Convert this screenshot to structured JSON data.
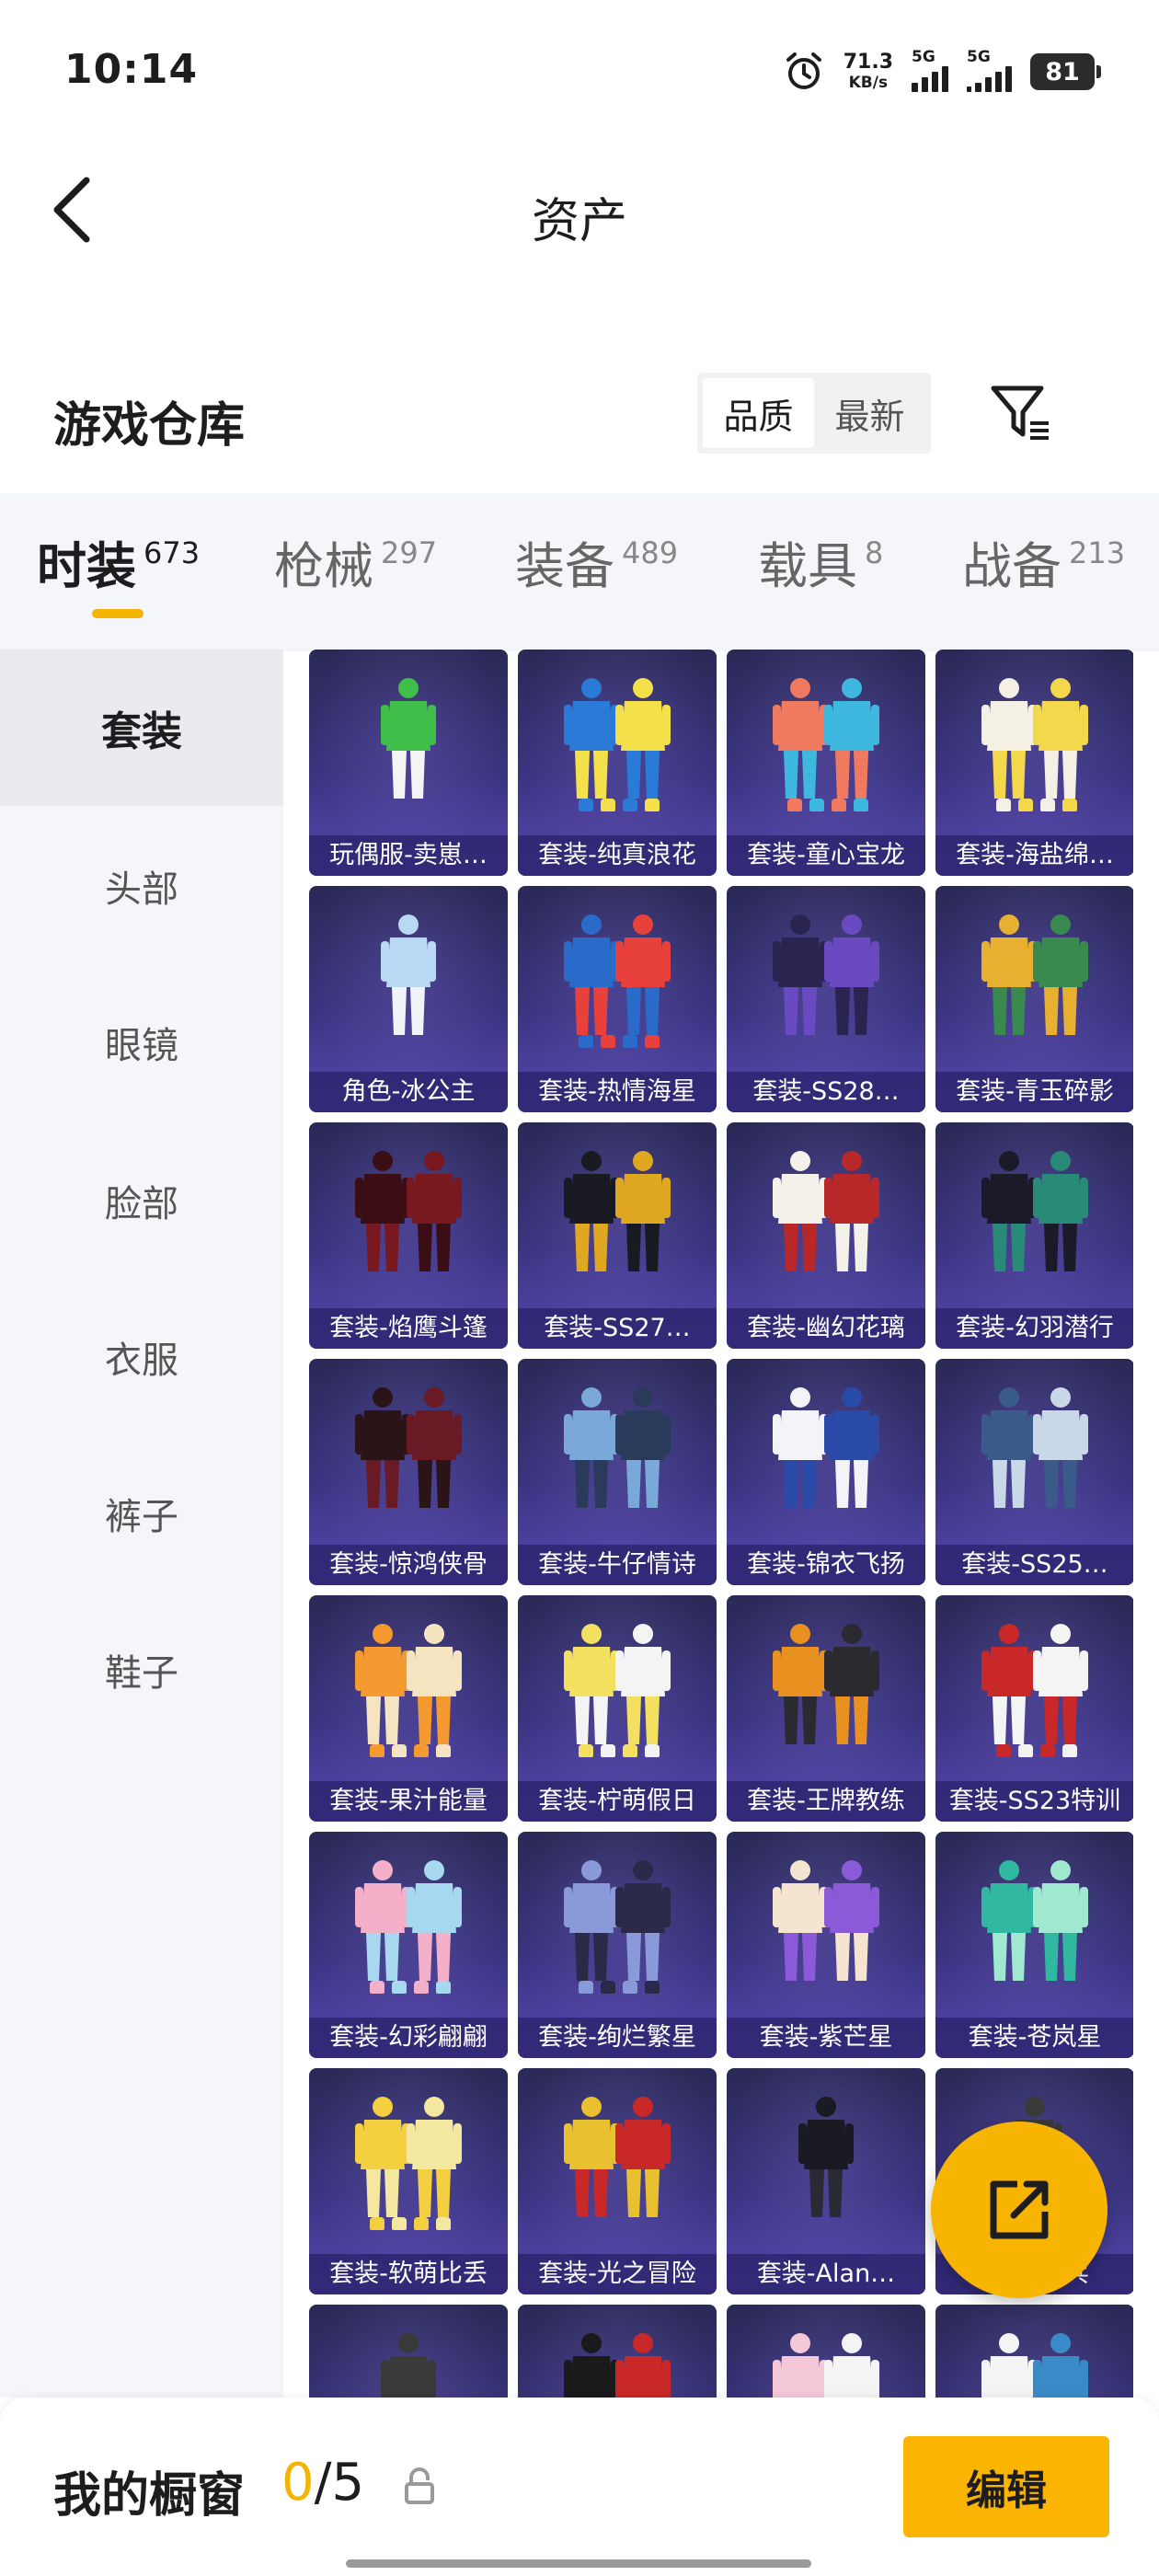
{
  "status_bar": {
    "time": "10:14",
    "net_speed_value": "71.3",
    "net_speed_unit": "KB/s",
    "sim1_type": "5G",
    "sim2_type": "5G",
    "battery": "81",
    "icons": [
      "alarm-icon",
      "signal-icon",
      "battery-icon"
    ]
  },
  "header": {
    "title": "资产",
    "back_icon": "chevron-left-icon"
  },
  "warehouse": {
    "title": "游戏仓库",
    "sort_options": [
      "品质",
      "最新"
    ],
    "sort_selected": "品质",
    "filter_icon": "filter-icon"
  },
  "category_tabs": [
    {
      "label": "时装",
      "count": "673",
      "active": true
    },
    {
      "label": "枪械",
      "count": "297",
      "active": false
    },
    {
      "label": "装备",
      "count": "489",
      "active": false
    },
    {
      "label": "载具",
      "count": "8",
      "active": false
    },
    {
      "label": "战备",
      "count": "213",
      "active": false
    }
  ],
  "accent_color": "#F5B400",
  "sidebar": {
    "items": [
      {
        "label": "套装",
        "active": true
      },
      {
        "label": "头部",
        "active": false
      },
      {
        "label": "眼镜",
        "active": false
      },
      {
        "label": "脸部",
        "active": false
      },
      {
        "label": "衣服",
        "active": false
      },
      {
        "label": "裤子",
        "active": false
      },
      {
        "label": "鞋子",
        "active": false
      }
    ]
  },
  "items": [
    {
      "label": "玩偶服-卖崽…",
      "colors": [
        "#3fbf4a",
        "#f4f4f4"
      ],
      "count": 1,
      "shoes": false
    },
    {
      "label": "套装-纯真浪花",
      "colors": [
        "#2a7ad8",
        "#f4e04a"
      ],
      "count": 2,
      "shoes": true
    },
    {
      "label": "套装-童心宝龙",
      "colors": [
        "#f07a60",
        "#3fb8e0"
      ],
      "count": 2,
      "shoes": true
    },
    {
      "label": "套装-海盐绵…",
      "colors": [
        "#f4f0e4",
        "#f2d84a"
      ],
      "count": 2,
      "shoes": true
    },
    {
      "label": "角色-冰公主",
      "colors": [
        "#b8d8f4",
        "#f0f4f8"
      ],
      "count": 1,
      "shoes": false
    },
    {
      "label": "套装-热情海星",
      "colors": [
        "#2a6ac8",
        "#e8403a"
      ],
      "count": 2,
      "shoes": true
    },
    {
      "label": "套装-SS28…",
      "colors": [
        "#2a2450",
        "#6a4ac0"
      ],
      "count": 2,
      "shoes": false
    },
    {
      "label": "套装-青玉碎影",
      "colors": [
        "#e8b030",
        "#3a8a50"
      ],
      "count": 2,
      "shoes": false
    },
    {
      "label": "套装-焰鹰斗篷",
      "colors": [
        "#3a0e14",
        "#7a1820"
      ],
      "count": 2,
      "shoes": false
    },
    {
      "label": "套装-SS27…",
      "colors": [
        "#1a1a22",
        "#e0a820"
      ],
      "count": 2,
      "shoes": false
    },
    {
      "label": "套装-幽幻花璃",
      "colors": [
        "#f4f0ea",
        "#b82828"
      ],
      "count": 2,
      "shoes": false
    },
    {
      "label": "套装-幻羽潜行",
      "colors": [
        "#1a1a28",
        "#2a8a78"
      ],
      "count": 2,
      "shoes": false
    },
    {
      "label": "套装-惊鸿侠骨",
      "colors": [
        "#2a1418",
        "#6a1a24"
      ],
      "count": 2,
      "shoes": false
    },
    {
      "label": "套装-牛仔情诗",
      "colors": [
        "#7aa8d8",
        "#2a3a5a"
      ],
      "count": 2,
      "shoes": false
    },
    {
      "label": "套装-锦衣飞扬",
      "colors": [
        "#f4f4f8",
        "#2a4aa8"
      ],
      "count": 2,
      "shoes": false
    },
    {
      "label": "套装-SS25…",
      "colors": [
        "#3a5a8a",
        "#c8d8e8"
      ],
      "count": 2,
      "shoes": false
    },
    {
      "label": "套装-果汁能量",
      "colors": [
        "#f49a30",
        "#f4e4c0"
      ],
      "count": 2,
      "shoes": true
    },
    {
      "label": "套装-柠萌假日",
      "colors": [
        "#f4e060",
        "#f4f4f4"
      ],
      "count": 2,
      "shoes": true
    },
    {
      "label": "套装-王牌教练",
      "colors": [
        "#e89020",
        "#2a2a30"
      ],
      "count": 2,
      "shoes": false
    },
    {
      "label": "套装-SS23特训",
      "colors": [
        "#c82828",
        "#f4f4f4"
      ],
      "count": 2,
      "shoes": true
    },
    {
      "label": "套装-幻彩翩翩",
      "colors": [
        "#f4b0c8",
        "#a8d8f0"
      ],
      "count": 2,
      "shoes": true
    },
    {
      "label": "套装-绚烂繁星",
      "colors": [
        "#8a9ad8",
        "#2a2a48"
      ],
      "count": 2,
      "shoes": true
    },
    {
      "label": "套装-紫芒星",
      "colors": [
        "#f4e4d0",
        "#8a5ad8"
      ],
      "count": 2,
      "shoes": false
    },
    {
      "label": "套装-苍岚星",
      "colors": [
        "#30b8a0",
        "#a0e8d0"
      ],
      "count": 2,
      "shoes": false
    },
    {
      "label": "套装-软萌比丢",
      "colors": [
        "#f4d040",
        "#f4e8a0"
      ],
      "count": 2,
      "shoes": true
    },
    {
      "label": "套装-光之冒险",
      "colors": [
        "#e8c030",
        "#c82828"
      ],
      "count": 2,
      "shoes": false
    },
    {
      "label": "套装-Alan…",
      "colors": [
        "#1a1a22",
        "#2a2a34"
      ],
      "count": 1,
      "shoes": false
    },
    {
      "label": "套装-…兵",
      "colors": [
        "#3a3a3a",
        "#5a5a5a"
      ],
      "count": 1,
      "shoes": false
    },
    {
      "label": "",
      "colors": [
        "#3a3a3a",
        "#7a7a70"
      ],
      "count": 1,
      "shoes": false
    },
    {
      "label": "",
      "colors": [
        "#1a1a1a",
        "#c82828"
      ],
      "count": 2,
      "shoes": false
    },
    {
      "label": "",
      "colors": [
        "#f4c8d8",
        "#f4f4f4"
      ],
      "count": 2,
      "shoes": false
    },
    {
      "label": "",
      "colors": [
        "#f4f4f4",
        "#3a8ac8"
      ],
      "count": 2,
      "shoes": false
    }
  ],
  "fab": {
    "icon": "share-icon"
  },
  "bottom_bar": {
    "window_label": "我的橱窗",
    "current": "0",
    "separator": "/",
    "max": "5",
    "lock_icon": "lock-icon",
    "edit_label": "编辑"
  }
}
